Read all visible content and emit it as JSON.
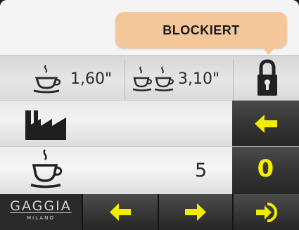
{
  "status_bubble": {
    "text": "BLOCKIERT"
  },
  "brew_times": {
    "single": {
      "icon": "single-cup-icon",
      "value": "1,60\""
    },
    "double": {
      "icon": "double-cup-icon",
      "value": "3,10\""
    },
    "lock": {
      "icon": "lock-icon"
    }
  },
  "factory_row": {
    "icon": "factory-icon",
    "action_icon": "back-arrow-icon"
  },
  "counter_row": {
    "icon": "single-cup-icon",
    "value": "5",
    "side_value": "0"
  },
  "bottom_bar": {
    "logo": {
      "name": "GAGGIA",
      "sub": "MILANO"
    },
    "buttons": [
      {
        "icon": "arrow-left-icon"
      },
      {
        "icon": "arrow-right-icon"
      },
      {
        "icon": "enter-icon"
      }
    ]
  },
  "colors": {
    "accent_yellow": "#f2ec00",
    "bubble": "#f3c79a",
    "dark": "#2a2a2a"
  }
}
